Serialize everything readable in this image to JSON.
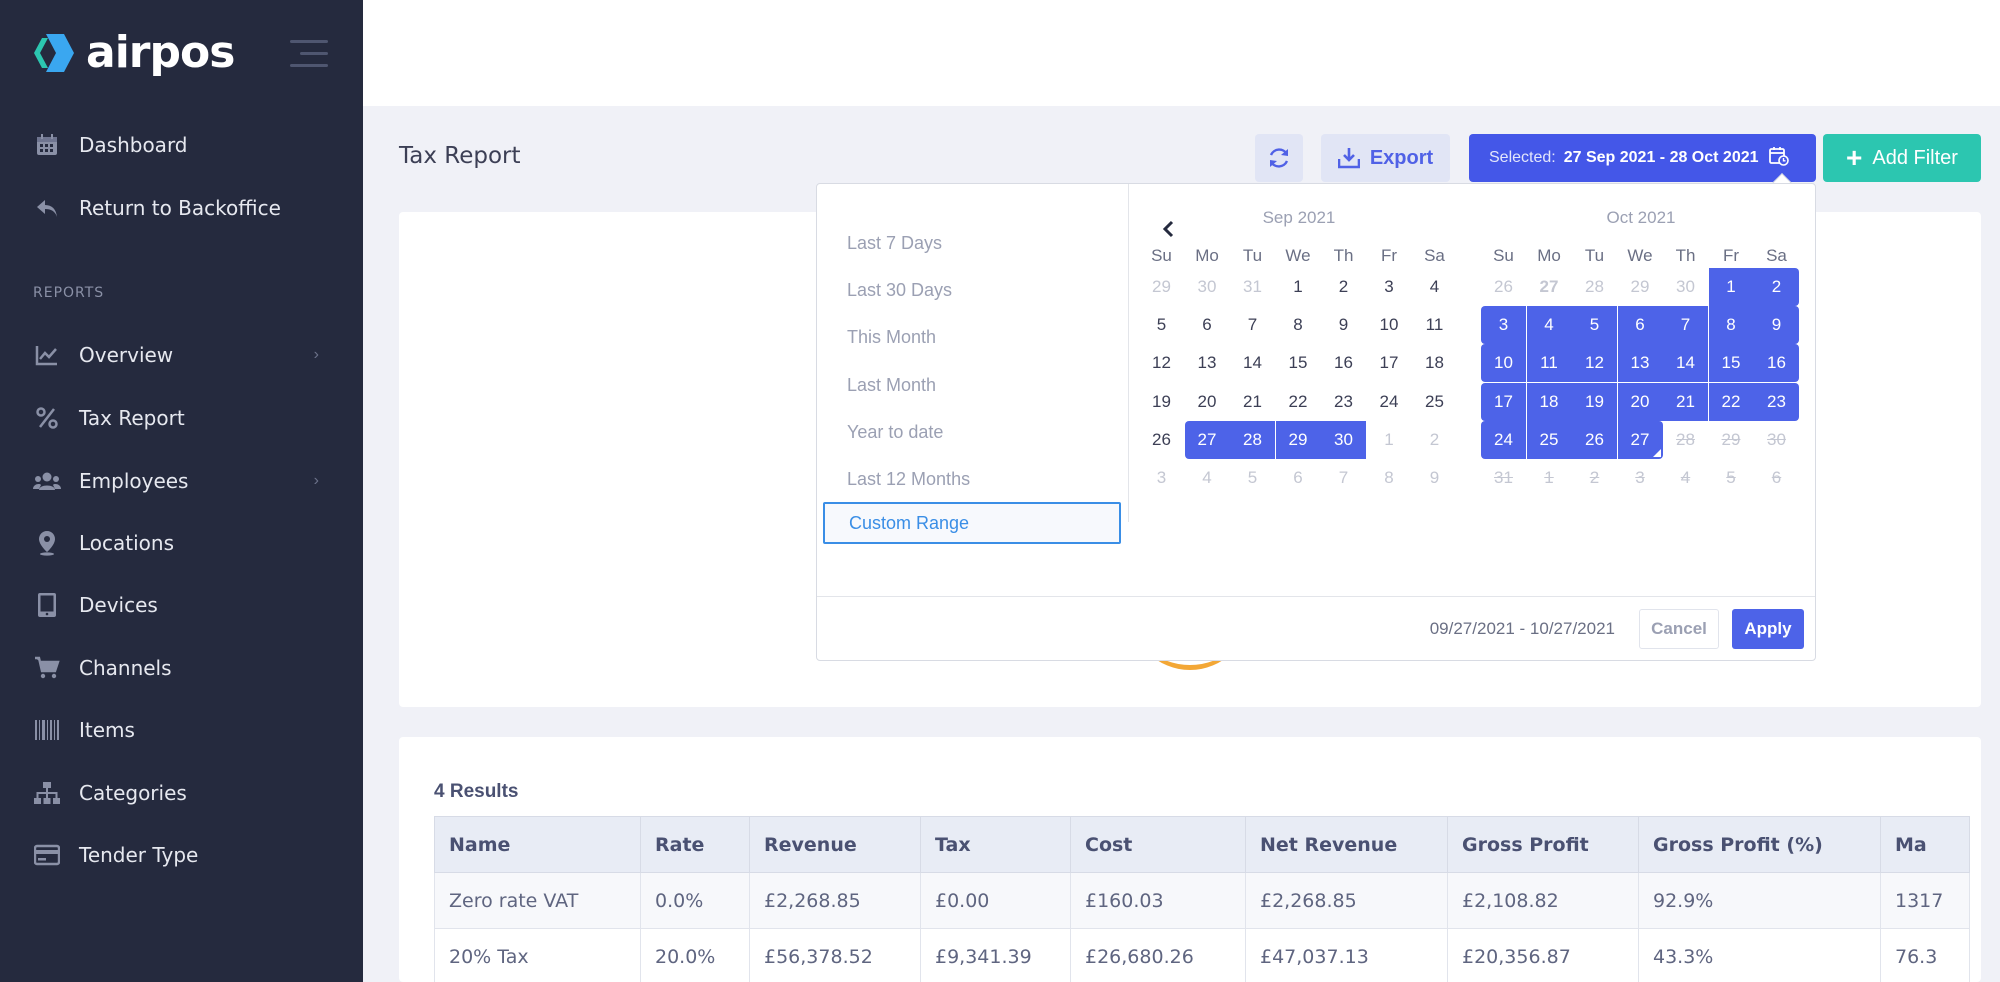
{
  "app": {
    "name": "airpos"
  },
  "sidebar": {
    "items_top": [
      {
        "label": "Dashboard",
        "icon": "calendar-icon"
      },
      {
        "label": "Return to Backoffice",
        "icon": "reply-icon"
      }
    ],
    "section_label": "REPORTS",
    "items": [
      {
        "label": "Overview",
        "icon": "chart-line-icon",
        "has_submenu": true
      },
      {
        "label": "Tax Report",
        "icon": "percent-icon",
        "has_submenu": false
      },
      {
        "label": "Employees",
        "icon": "users-icon",
        "has_submenu": true
      },
      {
        "label": "Locations",
        "icon": "map-pin-icon",
        "has_submenu": false
      },
      {
        "label": "Devices",
        "icon": "tablet-icon",
        "has_submenu": false
      },
      {
        "label": "Channels",
        "icon": "cart-icon",
        "has_submenu": false
      },
      {
        "label": "Items",
        "icon": "barcode-icon",
        "has_submenu": false
      },
      {
        "label": "Categories",
        "icon": "sitemap-icon",
        "has_submenu": false
      },
      {
        "label": "Tender Type",
        "icon": "credit-card-icon",
        "has_submenu": false
      }
    ],
    "chevron": "›"
  },
  "header": {
    "title": "Tax Report",
    "export_label": "Export",
    "selected_label": "Selected:",
    "selected_value": "27 Sep 2021 - 28 Oct 2021",
    "add_filter_label": "Add Filter",
    "add_filter_plus": "+"
  },
  "picker": {
    "ranges": [
      "Last 7 Days",
      "Last 30 Days",
      "This Month",
      "Last Month",
      "Year to date",
      "Last 12 Months",
      "Custom Range"
    ],
    "active_range": "Custom Range",
    "left_month": "Sep 2021",
    "right_month": "Oct 2021",
    "weekdays": [
      "Su",
      "Mo",
      "Tu",
      "We",
      "Th",
      "Fr",
      "Sa"
    ],
    "range_text": "09/27/2021 - 10/27/2021",
    "cancel_label": "Cancel",
    "apply_label": "Apply"
  },
  "table": {
    "results_label": "4 Results",
    "columns": [
      "Name",
      "Rate",
      "Revenue",
      "Tax",
      "Cost",
      "Net Revenue",
      "Gross Profit",
      "Gross Profit (%)",
      "Ma"
    ],
    "rows": [
      [
        "Zero rate VAT",
        "0.0%",
        "£2,268.85",
        "£0.00",
        "£160.03",
        "£2,268.85",
        "£2,108.82",
        "92.9%",
        "1317"
      ],
      [
        "20% Tax",
        "20.0%",
        "£56,378.52",
        "£9,341.39",
        "£26,680.26",
        "£47,037.13",
        "£20,356.87",
        "43.3%",
        "76.3"
      ]
    ]
  },
  "colors": {
    "sidebar_bg": "#252a3e",
    "accent_blue": "#4457e8",
    "teal": "#2cc6b0"
  }
}
